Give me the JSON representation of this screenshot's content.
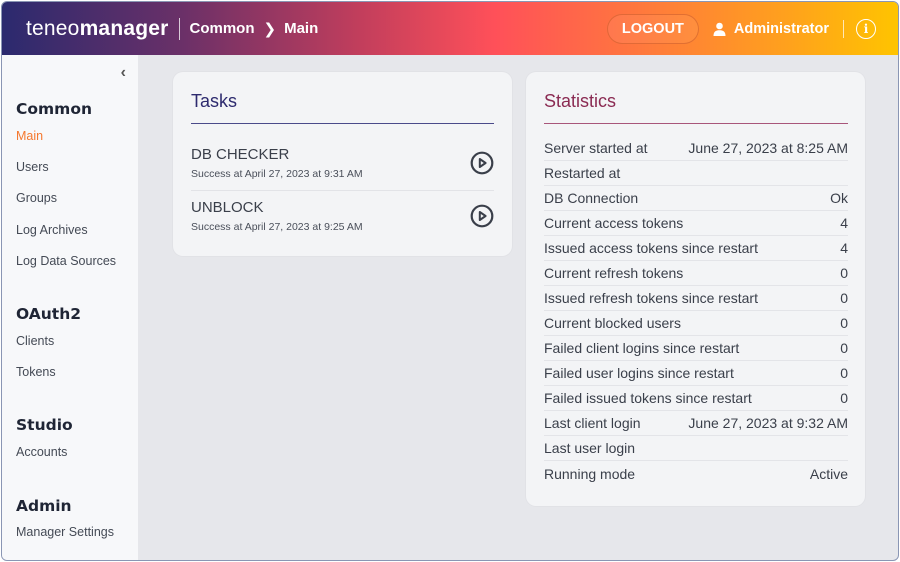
{
  "header": {
    "brand_light": "teneo",
    "brand_bold": "manager",
    "breadcrumb": [
      "Common",
      "Main"
    ],
    "logout_label": "LOGOUT",
    "user_name": "Administrator",
    "info_glyph": "i"
  },
  "sidebar": {
    "collapse_glyph": "‹",
    "sections": [
      {
        "title": "Common",
        "items": [
          "Main",
          "Users",
          "Groups",
          "Log Archives",
          "Log Data Sources"
        ]
      },
      {
        "title": "OAuth2",
        "items": [
          "Clients",
          "Tokens"
        ]
      },
      {
        "title": "Studio",
        "items": [
          "Accounts"
        ]
      },
      {
        "title": "Admin",
        "items": [
          "Manager Settings"
        ]
      }
    ],
    "active_item": "Main"
  },
  "tasks": {
    "title": "Tasks",
    "items": [
      {
        "name": "DB CHECKER",
        "status": "Success at April 27, 2023 at 9:31 AM"
      },
      {
        "name": "UNBLOCK",
        "status": "Success at April 27, 2023 at 9:25 AM"
      }
    ]
  },
  "statistics": {
    "title": "Statistics",
    "rows": [
      {
        "label": "Server started at",
        "value": "June 27, 2023 at 8:25 AM"
      },
      {
        "label": "Restarted at",
        "value": ""
      },
      {
        "label": "DB Connection",
        "value": "Ok"
      },
      {
        "label": "Current access tokens",
        "value": "4"
      },
      {
        "label": "Issued access tokens since restart",
        "value": "4"
      },
      {
        "label": "Current refresh tokens",
        "value": "0"
      },
      {
        "label": "Issued refresh tokens since restart",
        "value": "0"
      },
      {
        "label": "Current blocked users",
        "value": "0"
      },
      {
        "label": "Failed client logins since restart",
        "value": "0"
      },
      {
        "label": "Failed user logins since restart",
        "value": "0"
      },
      {
        "label": "Failed issued tokens since restart",
        "value": "0"
      },
      {
        "label": "Last client login",
        "value": "June 27, 2023 at 9:32 AM"
      },
      {
        "label": "Last user login",
        "value": ""
      },
      {
        "label": "Running mode",
        "value": "Active"
      }
    ]
  },
  "colors": {
    "accent_orange": "#f5782e",
    "tasks_title": "#2d2a6e",
    "stats_title": "#8a2a52"
  }
}
